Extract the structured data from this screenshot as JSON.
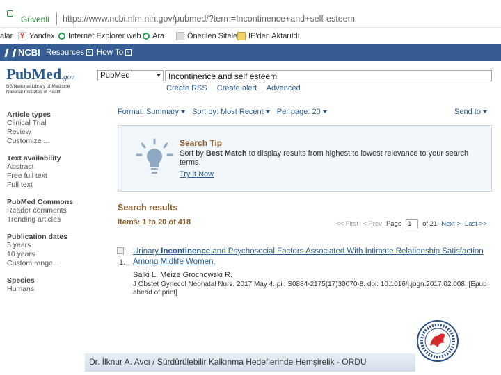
{
  "browser": {
    "secure_label": "Güvenli",
    "url": "https://www.ncbi.nlm.nih.gov/pubmed/?term=Incontinence+and+self-esteem"
  },
  "bookmarks": [
    {
      "label": "alar",
      "icon": "bookmark-icon"
    },
    {
      "label": "Yandex",
      "icon": "yandex-icon"
    },
    {
      "label": "Internet Explorer web",
      "icon": "search-icon"
    },
    {
      "label": "Ara",
      "icon": "search-icon"
    },
    {
      "label": "Önerilen Siteler",
      "icon": "bookmark-icon"
    },
    {
      "label": "IE'den Aktarıldı",
      "icon": "folder-icon"
    }
  ],
  "ncbi_bar": {
    "logo": "NCBI",
    "resources": "Resources",
    "howto": "How To"
  },
  "pubmed": {
    "logo_pub": "Pub",
    "logo_med": "Med",
    "logo_gov": ".gov",
    "subtitle_1": "US National Library of Medicine",
    "subtitle_2": "National Institutes of Health"
  },
  "search": {
    "database": "PubMed",
    "query": "Incontinence and self esteem",
    "create_rss": "Create RSS",
    "create_alert": "Create alert",
    "advanced": "Advanced"
  },
  "sidebar": [
    {
      "heading": "Article types",
      "items": [
        "Clinical Trial",
        "Review",
        "Customize ..."
      ]
    },
    {
      "heading": "Text availability",
      "items": [
        "Abstract",
        "Free full text",
        "Full text"
      ]
    },
    {
      "heading": "PubMed Commons",
      "items": [
        "Reader comments",
        "Trending articles"
      ]
    },
    {
      "heading": "Publication dates",
      "items": [
        "5 years",
        "10 years",
        "Custom range..."
      ]
    },
    {
      "heading": "Species",
      "items": [
        "Humans"
      ]
    }
  ],
  "toolbar": {
    "format": "Format: Summary",
    "sort": "Sort by: Most Recent",
    "per_page": "Per page: 20",
    "send_to": "Send to"
  },
  "tip": {
    "title": "Search Tip",
    "text_pre": "Sort by ",
    "text_bold": "Best Match",
    "text_post": " to display results from highest to lowest relevance to your search terms.",
    "link": "Try it Now"
  },
  "results": {
    "heading": "Search results",
    "items_label": "Items: 1 to 20 of 418",
    "pager": {
      "first": "<< First",
      "prev": "< Prev",
      "page_label": "Page",
      "page_value": "1",
      "of": "of 21",
      "next": "Next >",
      "last": "Last >>"
    },
    "first": {
      "number": "1.",
      "title_pre": "Urinary ",
      "title_bold": "Incontinence",
      "title_post": " and Psychosocial Factors Associated With Intimate Relationship Satisfaction Among Midlife Women.",
      "authors": "Salki L, Meize Grochowski R.",
      "citation": "J Obstet Gynecol Neonatal Nurs. 2017 May 4. pii: S0884-2175(17)30070-8. doi: 10.1016/j.jogn.2017.02.008. [Epub ahead of print]"
    }
  },
  "footer": {
    "text": "Dr. İlknur A. Avcı / Sürdürülebilir Kalkınma Hedeflerinde Hemşirelik - ORDU"
  },
  "colors": {
    "ncbi_blue": "#355c93",
    "link_blue": "#2b5b8f",
    "heading_brown": "#8b5a2b",
    "tip_bg": "#f1f6fa"
  }
}
